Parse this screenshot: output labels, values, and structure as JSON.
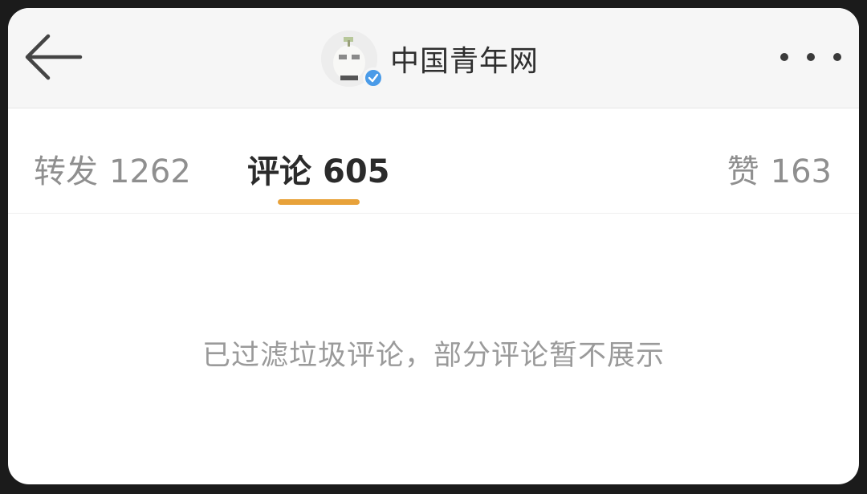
{
  "header": {
    "account_name": "中国青年网",
    "verified": true
  },
  "icons": {
    "back": "arrow-left-icon",
    "more": "more-dots-icon",
    "verified": "verified-badge-icon"
  },
  "tabs": [
    {
      "label": "转发",
      "count": "1262",
      "active": false
    },
    {
      "label": "评论",
      "count": "605",
      "active": true
    },
    {
      "label": "赞",
      "count": "163",
      "active": false
    }
  ],
  "notice": "已过滤垃圾评论，部分评论暂不展示",
  "colors": {
    "accent": "#e8a23a",
    "verified": "#4a9be8",
    "inactive_text": "#8f8f8f",
    "active_text": "#2b2b2b"
  }
}
